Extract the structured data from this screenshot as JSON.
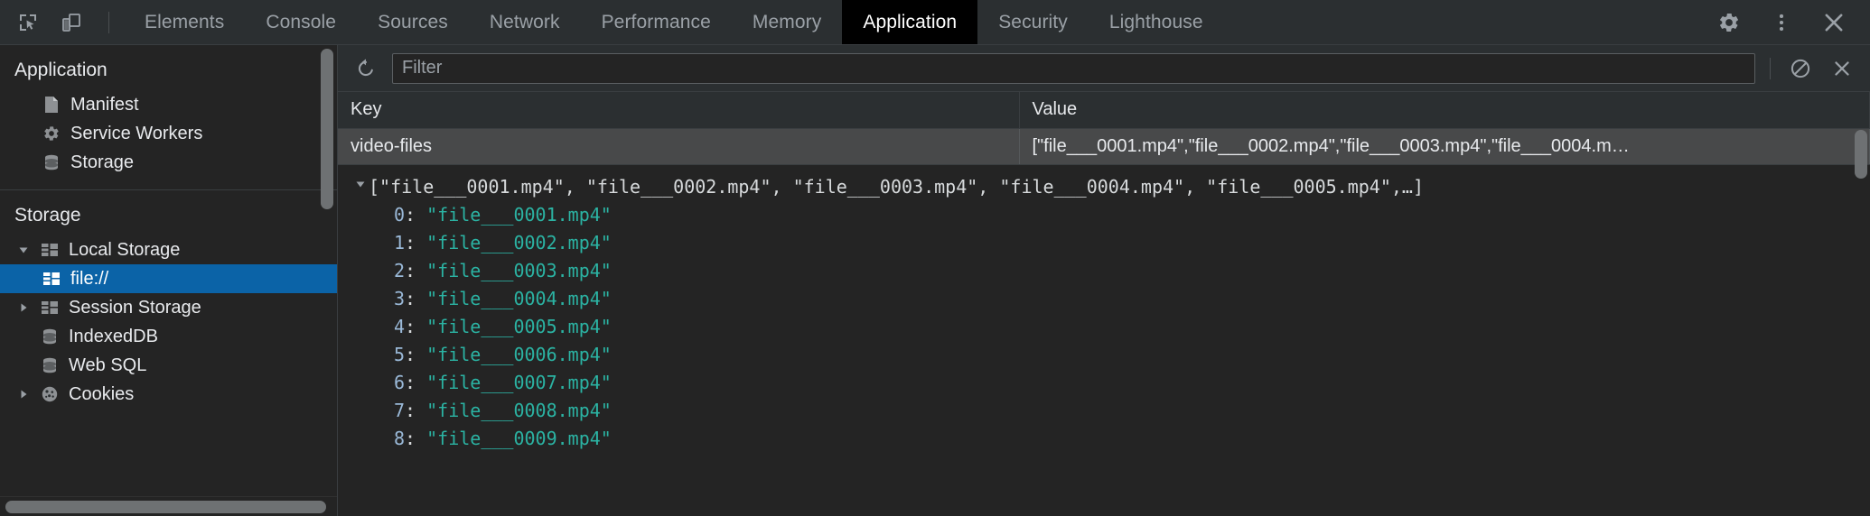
{
  "tabbar": {
    "left_icons": [
      {
        "name": "inspect-element-icon",
        "label": "Inspect element"
      },
      {
        "name": "device-toolbar-icon",
        "label": "Toggle device toolbar"
      }
    ],
    "tabs": [
      {
        "label": "Elements",
        "active": false
      },
      {
        "label": "Console",
        "active": false
      },
      {
        "label": "Sources",
        "active": false
      },
      {
        "label": "Network",
        "active": false
      },
      {
        "label": "Performance",
        "active": false
      },
      {
        "label": "Memory",
        "active": false
      },
      {
        "label": "Application",
        "active": true
      },
      {
        "label": "Security",
        "active": false
      },
      {
        "label": "Lighthouse",
        "active": false
      }
    ],
    "right_icons": [
      {
        "name": "gear-icon",
        "label": "Settings"
      },
      {
        "name": "more-options-icon",
        "label": "Customize and control DevTools"
      },
      {
        "name": "close-icon",
        "label": "Close DevTools"
      }
    ]
  },
  "sidebar": {
    "application": {
      "title": "Application",
      "items": [
        {
          "label": "Manifest",
          "icon": "document-icon",
          "selected": false
        },
        {
          "label": "Service Workers",
          "icon": "gear-icon",
          "selected": false
        },
        {
          "label": "Storage",
          "icon": "database-icon",
          "selected": false
        }
      ]
    },
    "storage": {
      "title": "Storage",
      "items": [
        {
          "label": "Local Storage",
          "icon": "table-icon",
          "twisty": "expanded",
          "indent": 1,
          "selected": false
        },
        {
          "label": "file://",
          "icon": "table-icon",
          "twisty": "none",
          "indent": 2,
          "selected": true
        },
        {
          "label": "Session Storage",
          "icon": "table-icon",
          "twisty": "collapsed",
          "indent": 1,
          "selected": false
        },
        {
          "label": "IndexedDB",
          "icon": "database-icon",
          "twisty": "none",
          "indent": 1,
          "selected": false
        },
        {
          "label": "Web SQL",
          "icon": "database-icon",
          "twisty": "none",
          "indent": 1,
          "selected": false
        },
        {
          "label": "Cookies",
          "icon": "cookie-icon",
          "twisty": "collapsed",
          "indent": 1,
          "selected": false
        }
      ]
    }
  },
  "toolbar": {
    "refresh_label": "Refresh",
    "filter_placeholder": "Filter",
    "filter_value": "",
    "clear_all_label": "Clear all",
    "delete_label": "Delete selected"
  },
  "table": {
    "columns": [
      "Key",
      "Value"
    ],
    "rows": [
      {
        "key": "video-files",
        "value": "[\"file___0001.mp4\",\"file___0002.mp4\",\"file___0003.mp4\",\"file___0004.m…",
        "selected": true
      }
    ]
  },
  "preview": {
    "summary": "[\"file___0001.mp4\", \"file___0002.mp4\", \"file___0003.mp4\", \"file___0004.mp4\", \"file___0005.mp4\",…]",
    "entries": [
      {
        "index": "0",
        "value": "\"file___0001.mp4\""
      },
      {
        "index": "1",
        "value": "\"file___0002.mp4\""
      },
      {
        "index": "2",
        "value": "\"file___0003.mp4\""
      },
      {
        "index": "3",
        "value": "\"file___0004.mp4\""
      },
      {
        "index": "4",
        "value": "\"file___0005.mp4\""
      },
      {
        "index": "5",
        "value": "\"file___0006.mp4\""
      },
      {
        "index": "6",
        "value": "\"file___0007.mp4\""
      },
      {
        "index": "7",
        "value": "\"file___0008.mp4\""
      },
      {
        "index": "8",
        "value": "\"file___0009.mp4\""
      }
    ]
  },
  "colors": {
    "background": "#242424",
    "panel": "#2b2f31",
    "selection_blue": "#0b63a7",
    "row_selected": "#48494a",
    "string_teal": "#2bb3a3",
    "index_blue": "#9ab9d8",
    "text": "#e8eaed",
    "muted_text": "#9aa0a6"
  }
}
